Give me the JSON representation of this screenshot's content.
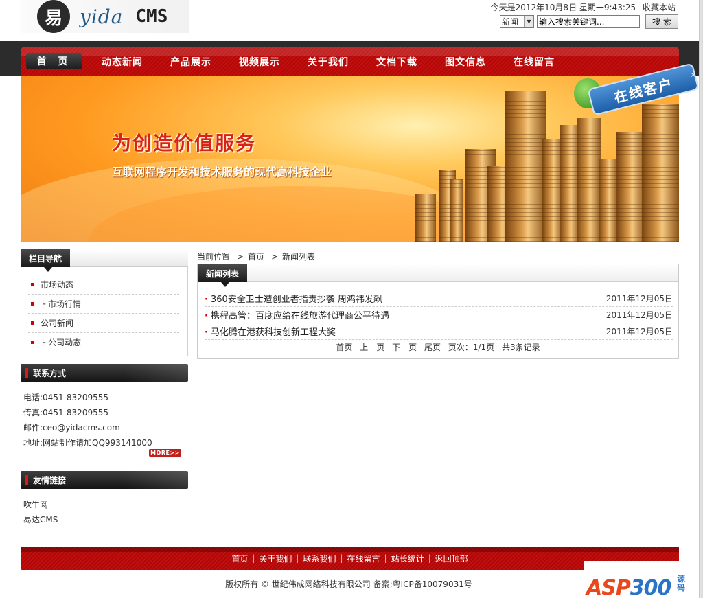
{
  "header": {
    "logo_glyph": "易",
    "logo_text": "yida",
    "logo_cms": "CMS",
    "date_text": "今天是2012年10月8日 星期一9:43:25",
    "bookmark_label": "收藏本站",
    "search_select_value": "新闻",
    "search_input_value": "输入搜索关键词...",
    "search_button_label": "搜 索"
  },
  "nav": {
    "home": "首 页",
    "items": [
      "动态新闻",
      "产品展示",
      "视频展示",
      "关于我们",
      "文档下载",
      "图文信息",
      "在线留言"
    ]
  },
  "banner": {
    "headline": "为创造价值服务",
    "subline": "互联网程序开发和技术服务的现代高科技企业",
    "online_badge": "在线客户",
    "badge_close": "×"
  },
  "sidebar": {
    "nav_title": "栏目导航",
    "nav_items": [
      "市场动态",
      "├ 市场行情",
      "公司新闻",
      "├ 公司动态"
    ],
    "contact_title": "联系方式",
    "contact": {
      "phone": "电话:0451-83209555",
      "fax": "传真:0451-83209555",
      "email": "邮件:ceo@yidacms.com",
      "address": "地址:网站制作请加QQ993141000"
    },
    "more_label": "MORE>>",
    "links_title": "友情链接",
    "links": [
      "吹牛网",
      "易达CMS"
    ]
  },
  "main": {
    "breadcrumb": "当前位置  -> 首页  -> 新闻列表",
    "list_title": "新闻列表",
    "news": [
      {
        "title": "360安全卫士遭创业者指责抄袭 周鸿祎发飙",
        "date": "2011年12月05日"
      },
      {
        "title": "携程高管：百度应给在线旅游代理商公平待遇",
        "date": "2011年12月05日"
      },
      {
        "title": "马化腾在港获科技创新工程大奖",
        "date": "2011年12月05日"
      }
    ],
    "pager": {
      "first": "首页",
      "prev": "上一页",
      "next": "下一页",
      "last": "尾页",
      "page_info": "页次：1/1页",
      "count": "共3条记录"
    }
  },
  "footer": {
    "links": [
      "首页",
      "关于我们",
      "联系我们",
      "在线留言",
      "站长统计",
      "返回顶部"
    ],
    "copyright": "版权所有 © 世纪伟成网络科技有限公司  备案:粤ICP备10079031号"
  },
  "watermark": {
    "asp": "ASP",
    "num": "300",
    "cn1": "源",
    "cn2": "码"
  },
  "colors": {
    "nav_red": "#c40f0f",
    "dark_bar": "#2c2c2c",
    "banner_orange": "#ff9a20",
    "headline_red": "#d8231a"
  }
}
